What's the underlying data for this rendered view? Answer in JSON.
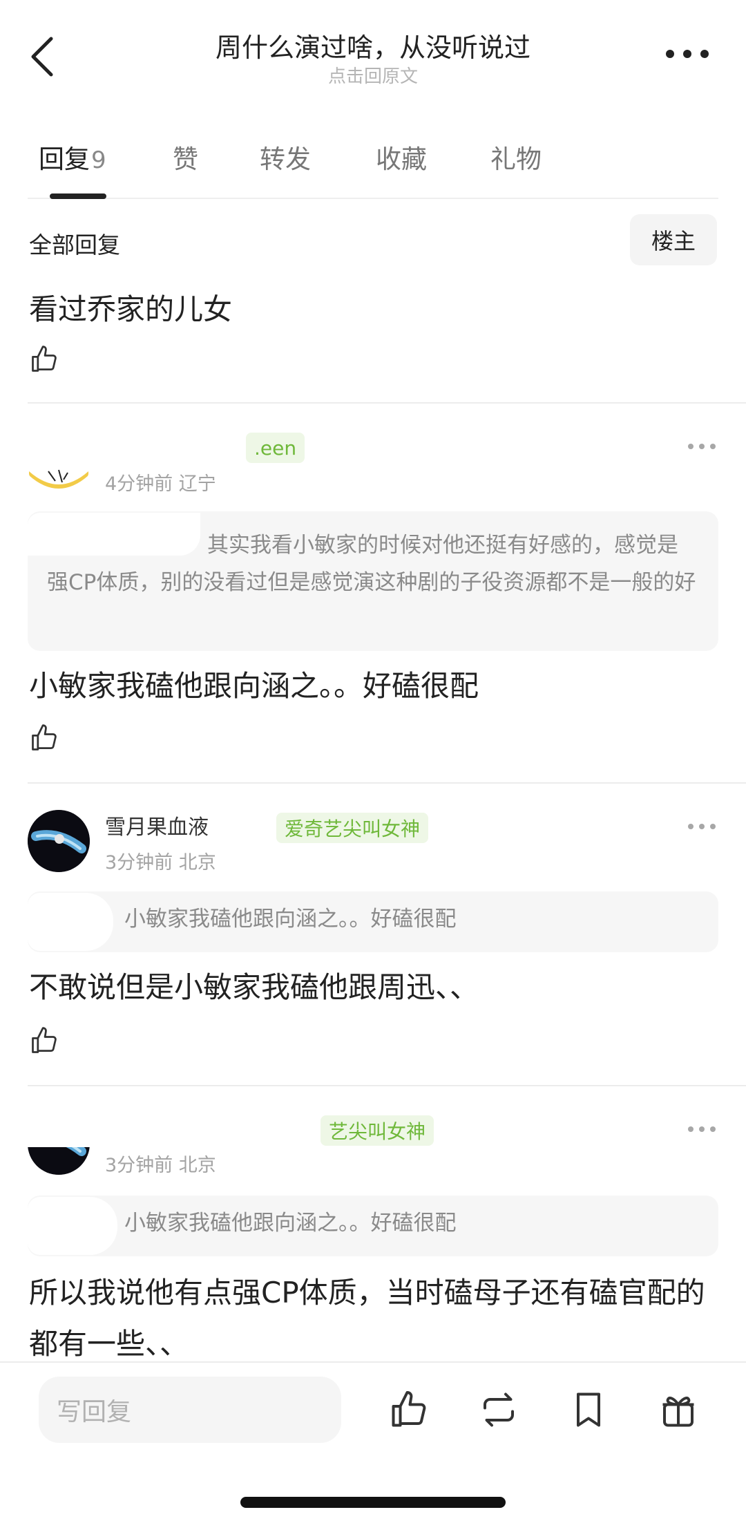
{
  "header": {
    "title": "周什么演过啥，从没听说过",
    "subtitle": "点击回原文",
    "back_icon": "chevron-left-icon",
    "more_icon": "more-horizontal-icon"
  },
  "tabs": [
    {
      "label": "回复",
      "count": "9",
      "active": true
    },
    {
      "label": "赞"
    },
    {
      "label": "转发"
    },
    {
      "label": "收藏"
    },
    {
      "label": "礼物"
    }
  ],
  "section": {
    "title": "全部回复",
    "op_button": "楼主"
  },
  "original_post": {
    "text": "看过乔家的儿女"
  },
  "replies": [
    {
      "username": "",
      "badge": ".een",
      "meta": "4分钟前 辽宁",
      "quote": "其实我看小敏家的时候对他还挺有好感的，感觉是强CP体质，别的没看过但是感觉演这种剧的子役资源都不是一般的好",
      "text": "小敏家我磕他跟向涵之。。好磕很配"
    },
    {
      "username": "雪月果血液",
      "badge": "爱奇艺尖叫女神",
      "meta": "3分钟前 北京",
      "quote": "小敏家我磕他跟向涵之。。好磕很配",
      "text": "不敢说但是小敏家我磕他跟周迅、、"
    },
    {
      "username": "",
      "badge": "艺尖叫女神",
      "meta": "3分钟前 北京",
      "quote": "小敏家我磕他跟向涵之。。好磕很配",
      "text": "所以我说他有点强CP体质，当时磕母子还有磕官配的都有一些、、"
    }
  ],
  "bottom_bar": {
    "input_placeholder": "写回复",
    "icons": [
      "thumbs-up-icon",
      "repost-icon",
      "bookmark-icon",
      "gift-icon"
    ]
  },
  "colors": {
    "badge_bg": "#eef7e6",
    "badge_text": "#6fb83a",
    "quote_bg": "#f6f6f6",
    "text_primary": "#222222",
    "text_muted": "#a3a3a3"
  }
}
